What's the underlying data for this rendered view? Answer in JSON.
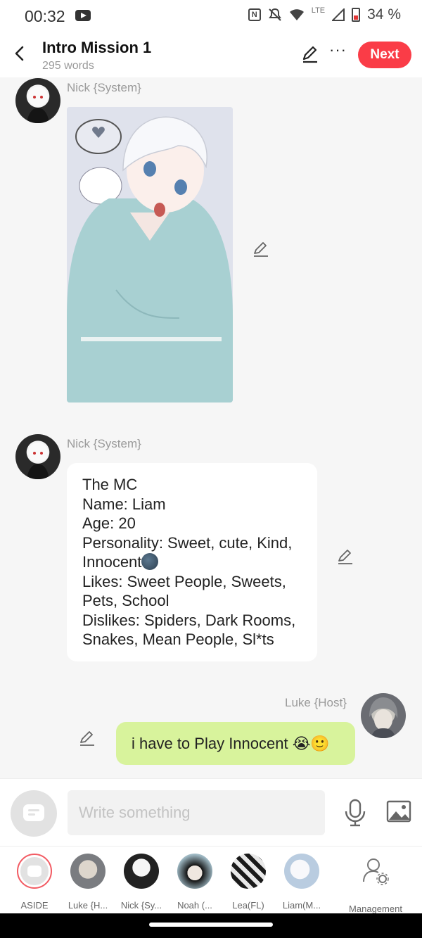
{
  "status_bar": {
    "time": "00:32",
    "network": "LTE",
    "battery": "34 %"
  },
  "header": {
    "title": "Intro Mission 1",
    "subtitle": "295 words",
    "next_label": "Next",
    "more_label": "···"
  },
  "messages": [
    {
      "sender": "Nick {System}",
      "type": "image"
    },
    {
      "sender": "Nick {System}",
      "type": "text",
      "lines": [
        "The MC",
        "Name: Liam",
        "Age: 20",
        "Personality: Sweet, cute, Kind,",
        "Innocent",
        "Likes: Sweet People, Sweets,",
        "Pets, School",
        "Dislikes: Spiders, Dark Rooms,",
        "Snakes, Mean People, Sl*ts"
      ]
    },
    {
      "sender": "Luke {Host}",
      "type": "text",
      "text": "i have to Play Innocent 😭🙂"
    }
  ],
  "composer": {
    "placeholder": "Write something"
  },
  "roles": [
    {
      "label": "ASIDE"
    },
    {
      "label": "Luke {H..."
    },
    {
      "label": "Nick {Sy..."
    },
    {
      "label": "Noah (..."
    },
    {
      "label": "Lea(FL)"
    },
    {
      "label": "Liam(M..."
    },
    {
      "label": "Management"
    }
  ],
  "colors": {
    "accent": "#fa3c47",
    "host_bubble": "#d8f39c",
    "background": "#f6f6f6"
  }
}
